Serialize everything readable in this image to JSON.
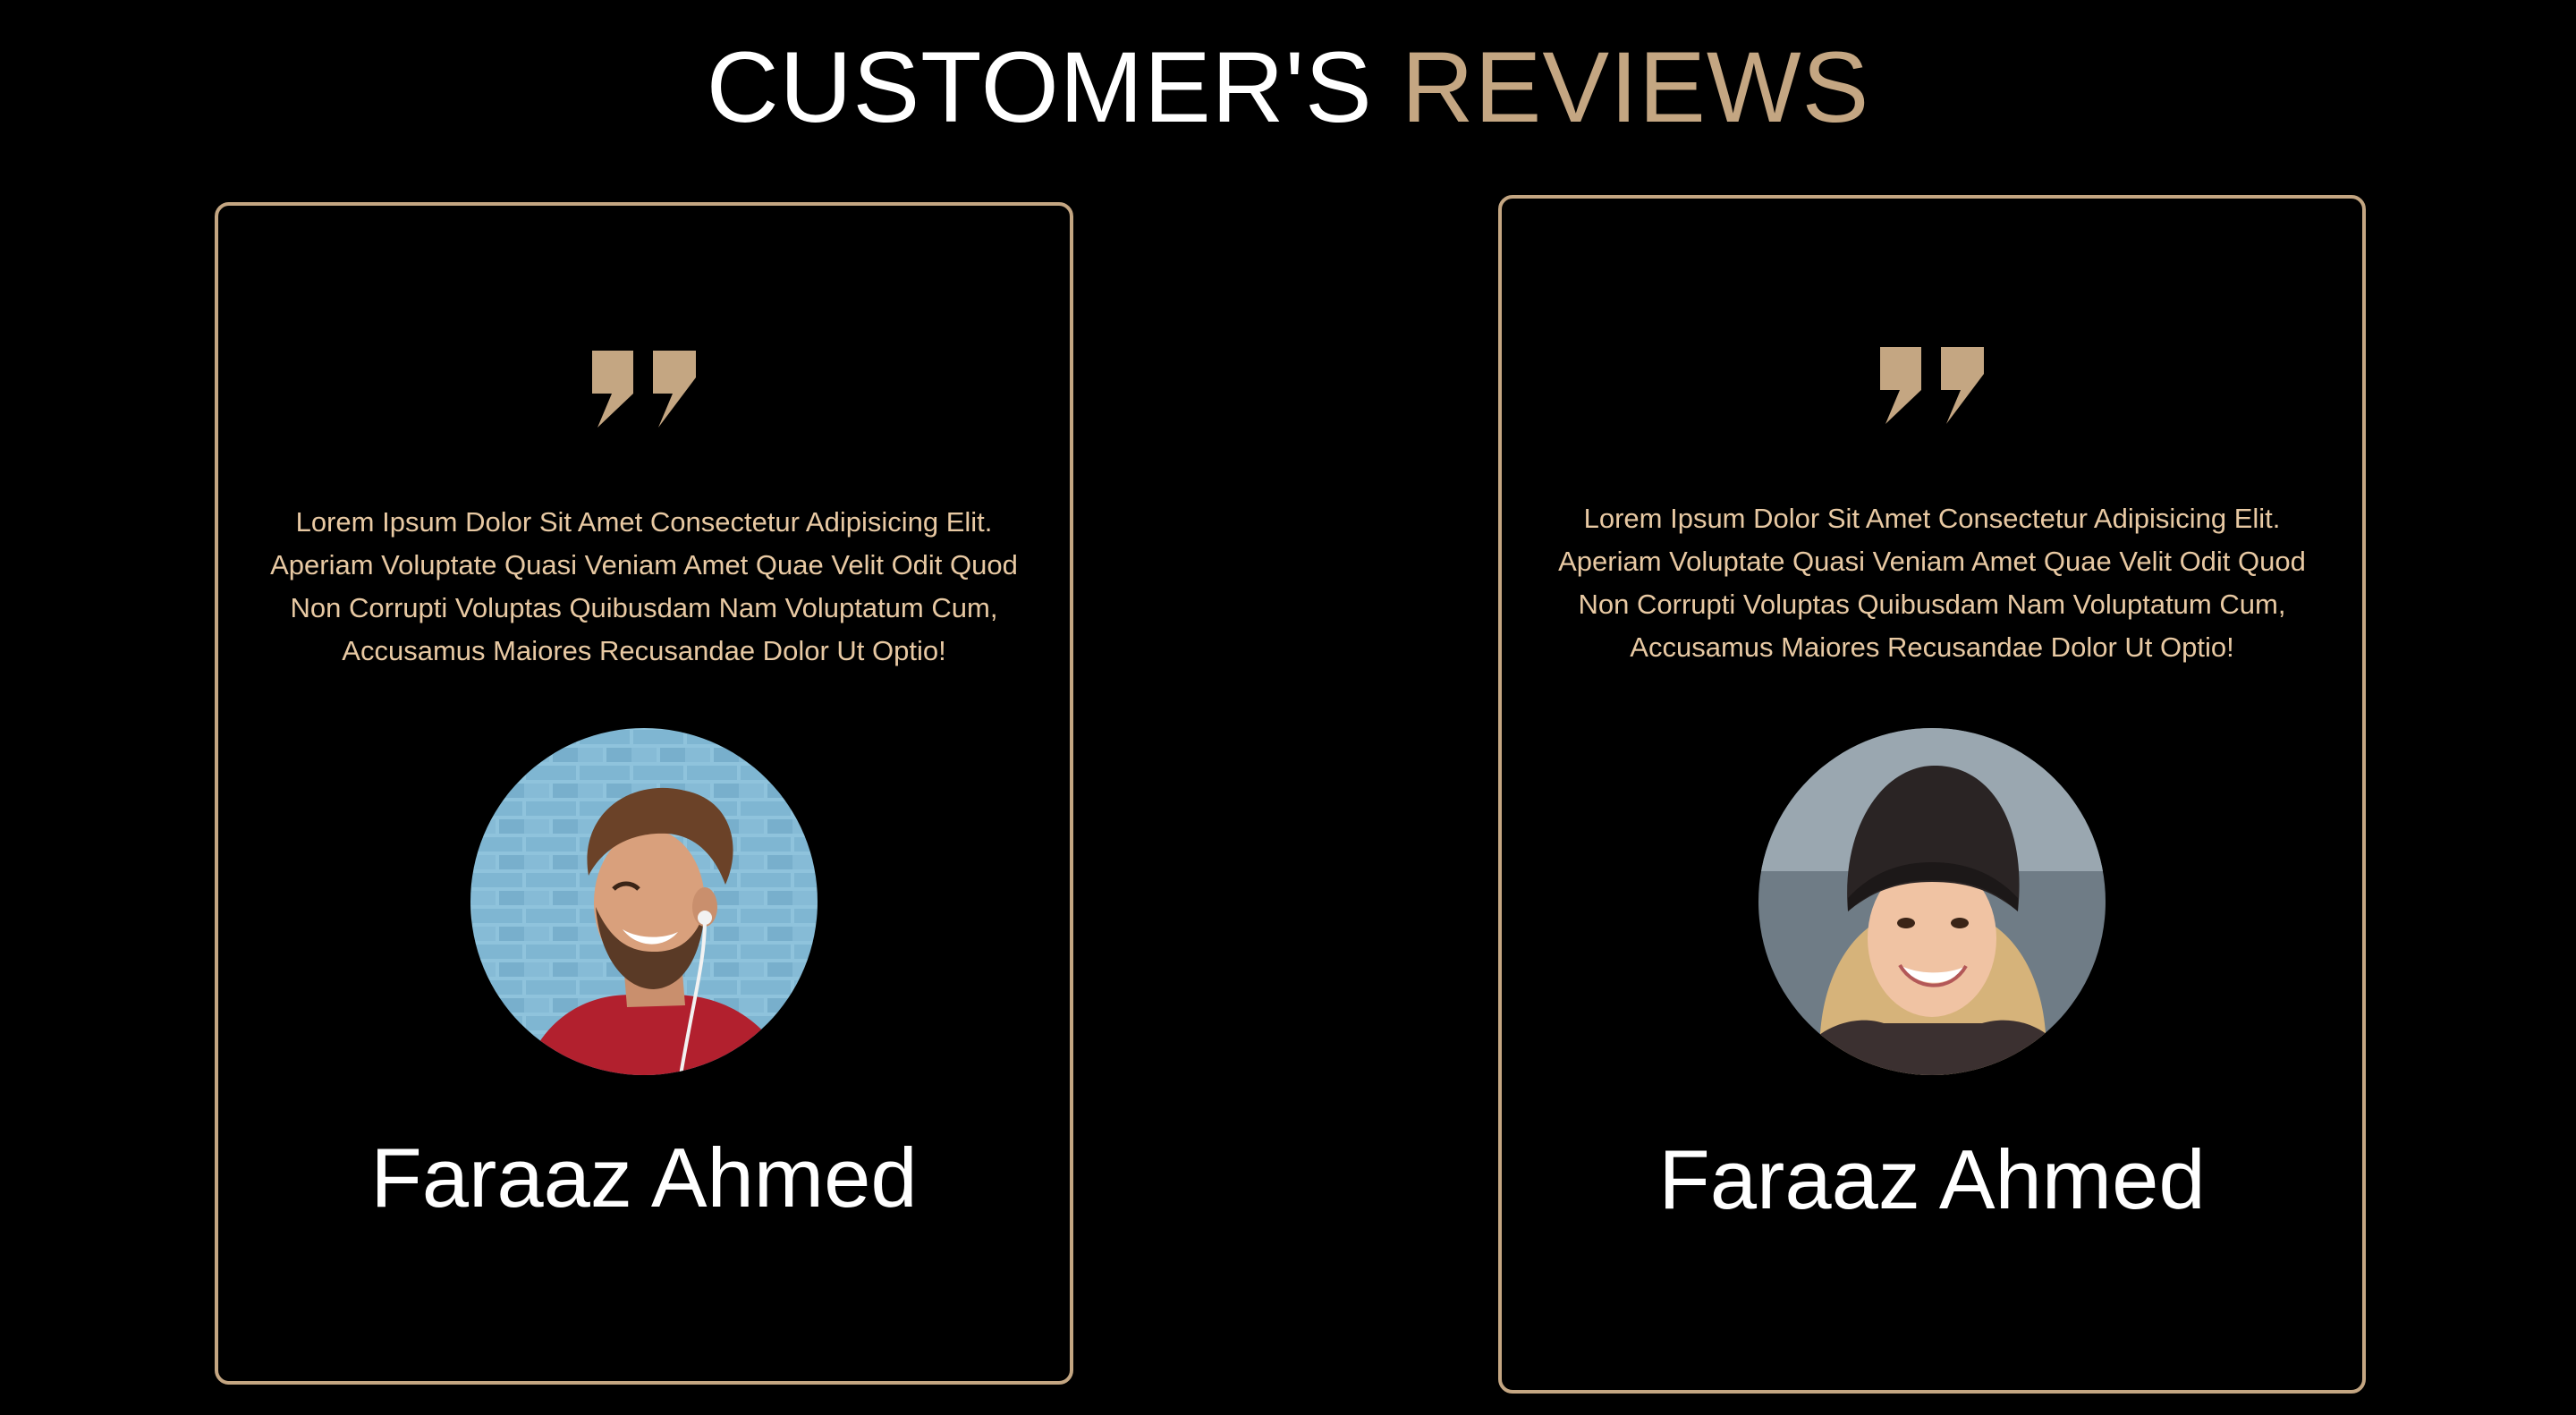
{
  "heading": {
    "title_part1": "CUSTOMER'S ",
    "title_part2": "REVIEWS"
  },
  "colors": {
    "background": "#000000",
    "accent": "#c4a682",
    "review_text": "#e8c9a3",
    "name_text": "#ffffff"
  },
  "reviews": [
    {
      "quote_icon": "quote-mark-icon",
      "text": "Lorem Ipsum Dolor Sit Amet Consectetur Adipisicing Elit. Aperiam Voluptate Quasi Veniam Amet Quae Velit Odit Quod Non Corrupti Voluptas Quibusdam Nam Voluptatum Cum, Accusamus Maiores Recusandae Dolor Ut Optio!",
      "avatar": "smiling-man-with-earphones-photo",
      "name": "Faraaz Ahmed"
    },
    {
      "quote_icon": "quote-mark-icon",
      "text": "Lorem Ipsum Dolor Sit Amet Consectetur Adipisicing Elit. Aperiam Voluptate Quasi Veniam Amet Quae Velit Odit Quod Non Corrupti Voluptas Quibusdam Nam Voluptatum Cum, Accusamus Maiores Recusandae Dolor Ut Optio!",
      "avatar": "smiling-woman-in-beanie-photo",
      "name": "Faraaz Ahmed"
    }
  ]
}
